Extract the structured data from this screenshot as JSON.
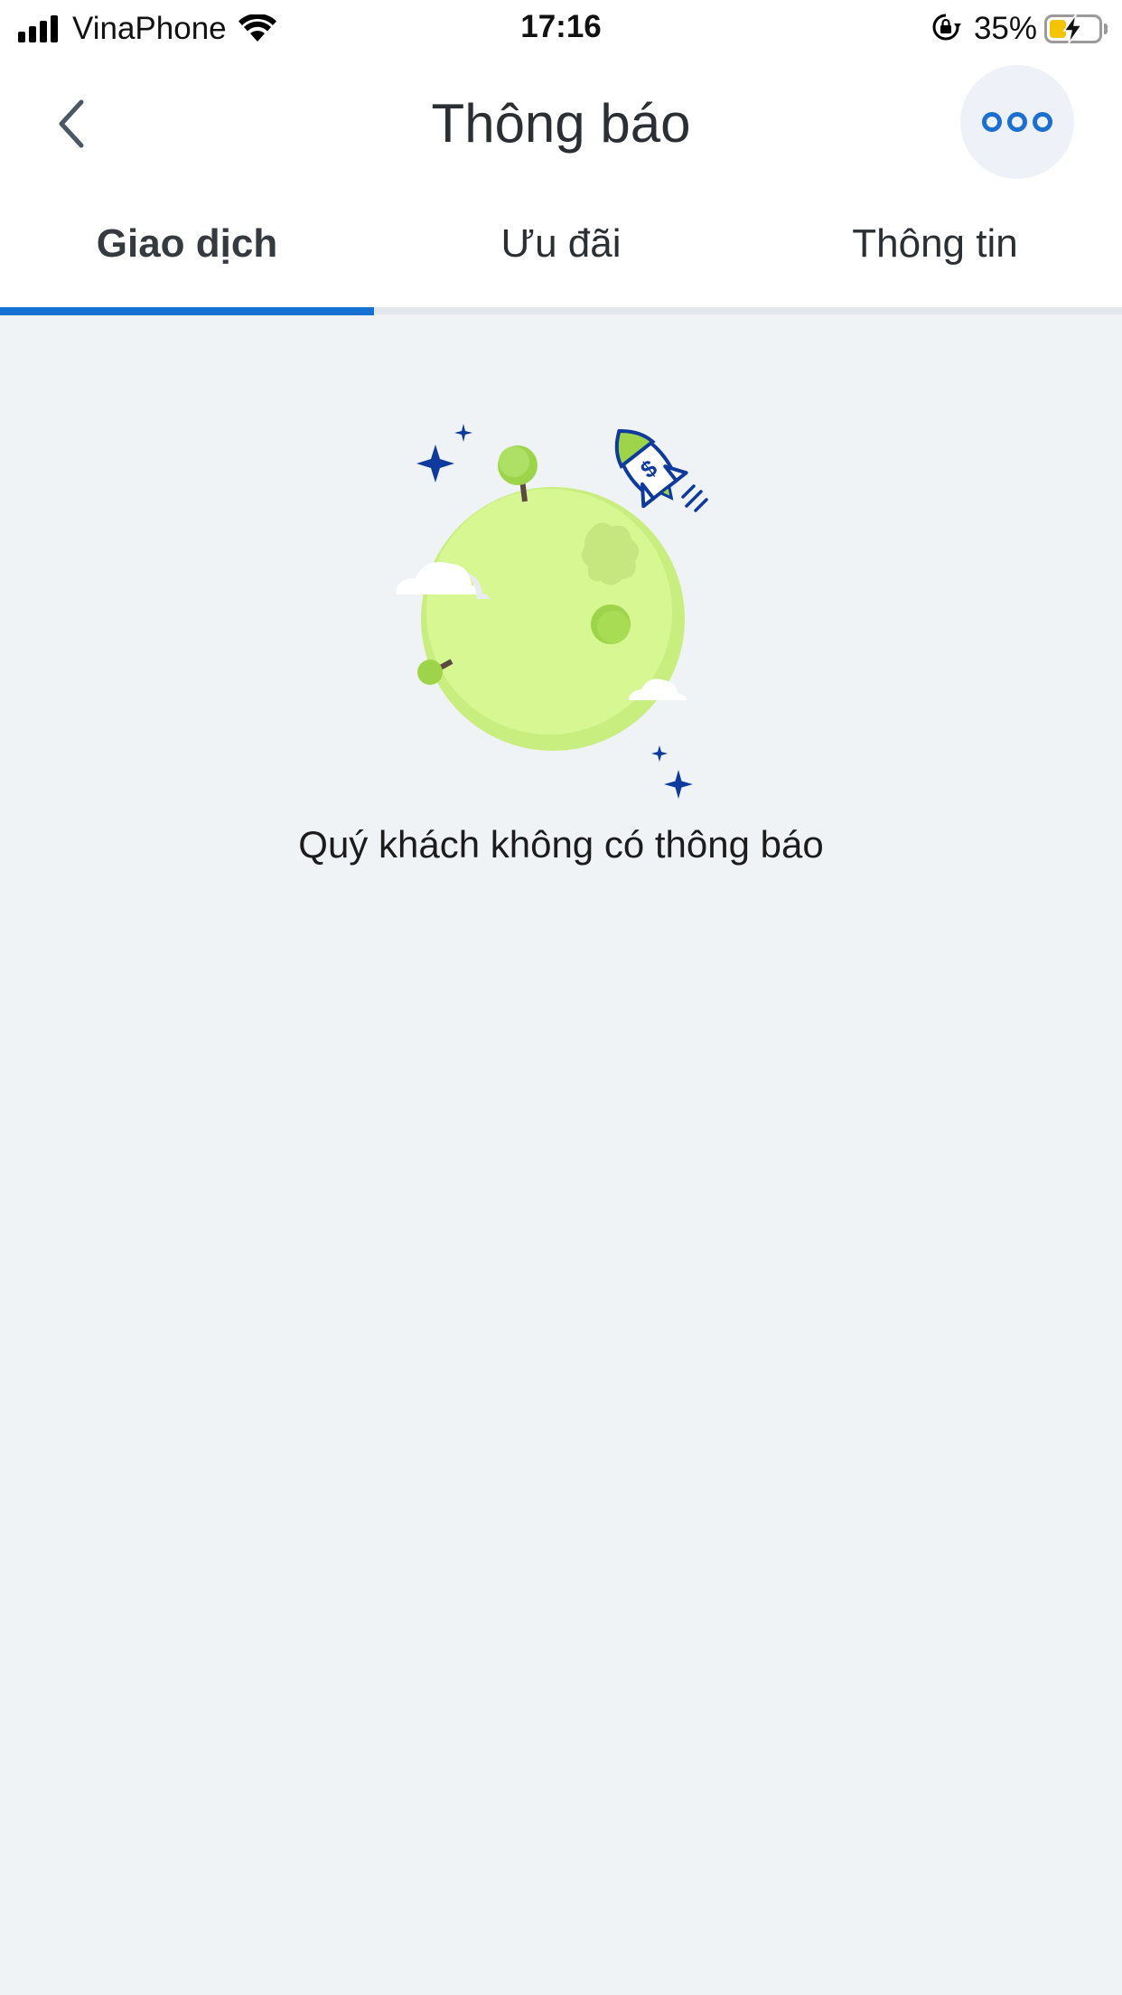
{
  "status_bar": {
    "carrier": "VinaPhone",
    "time": "17:16",
    "battery_percent": "35%",
    "battery_level": 0.35,
    "icons": [
      "signal-icon",
      "wifi-icon",
      "rotation-lock-icon",
      "battery-charging-icon"
    ]
  },
  "header": {
    "title": "Thông báo",
    "back_icon": "chevron-left-icon",
    "more_icon": "more-dots-icon"
  },
  "tabs": [
    {
      "label": "Giao dịch",
      "active": true
    },
    {
      "label": "Ưu đãi",
      "active": false
    },
    {
      "label": "Thông tin",
      "active": false
    }
  ],
  "empty_state": {
    "illustration": "planet-rocket-illustration",
    "message": "Quý khách không có thông báo"
  },
  "colors": {
    "accent": "#1572d3",
    "background": "#f0f3f6",
    "planet": "#d6f792",
    "star": "#0d3a9c",
    "battery": "#f5c400"
  }
}
